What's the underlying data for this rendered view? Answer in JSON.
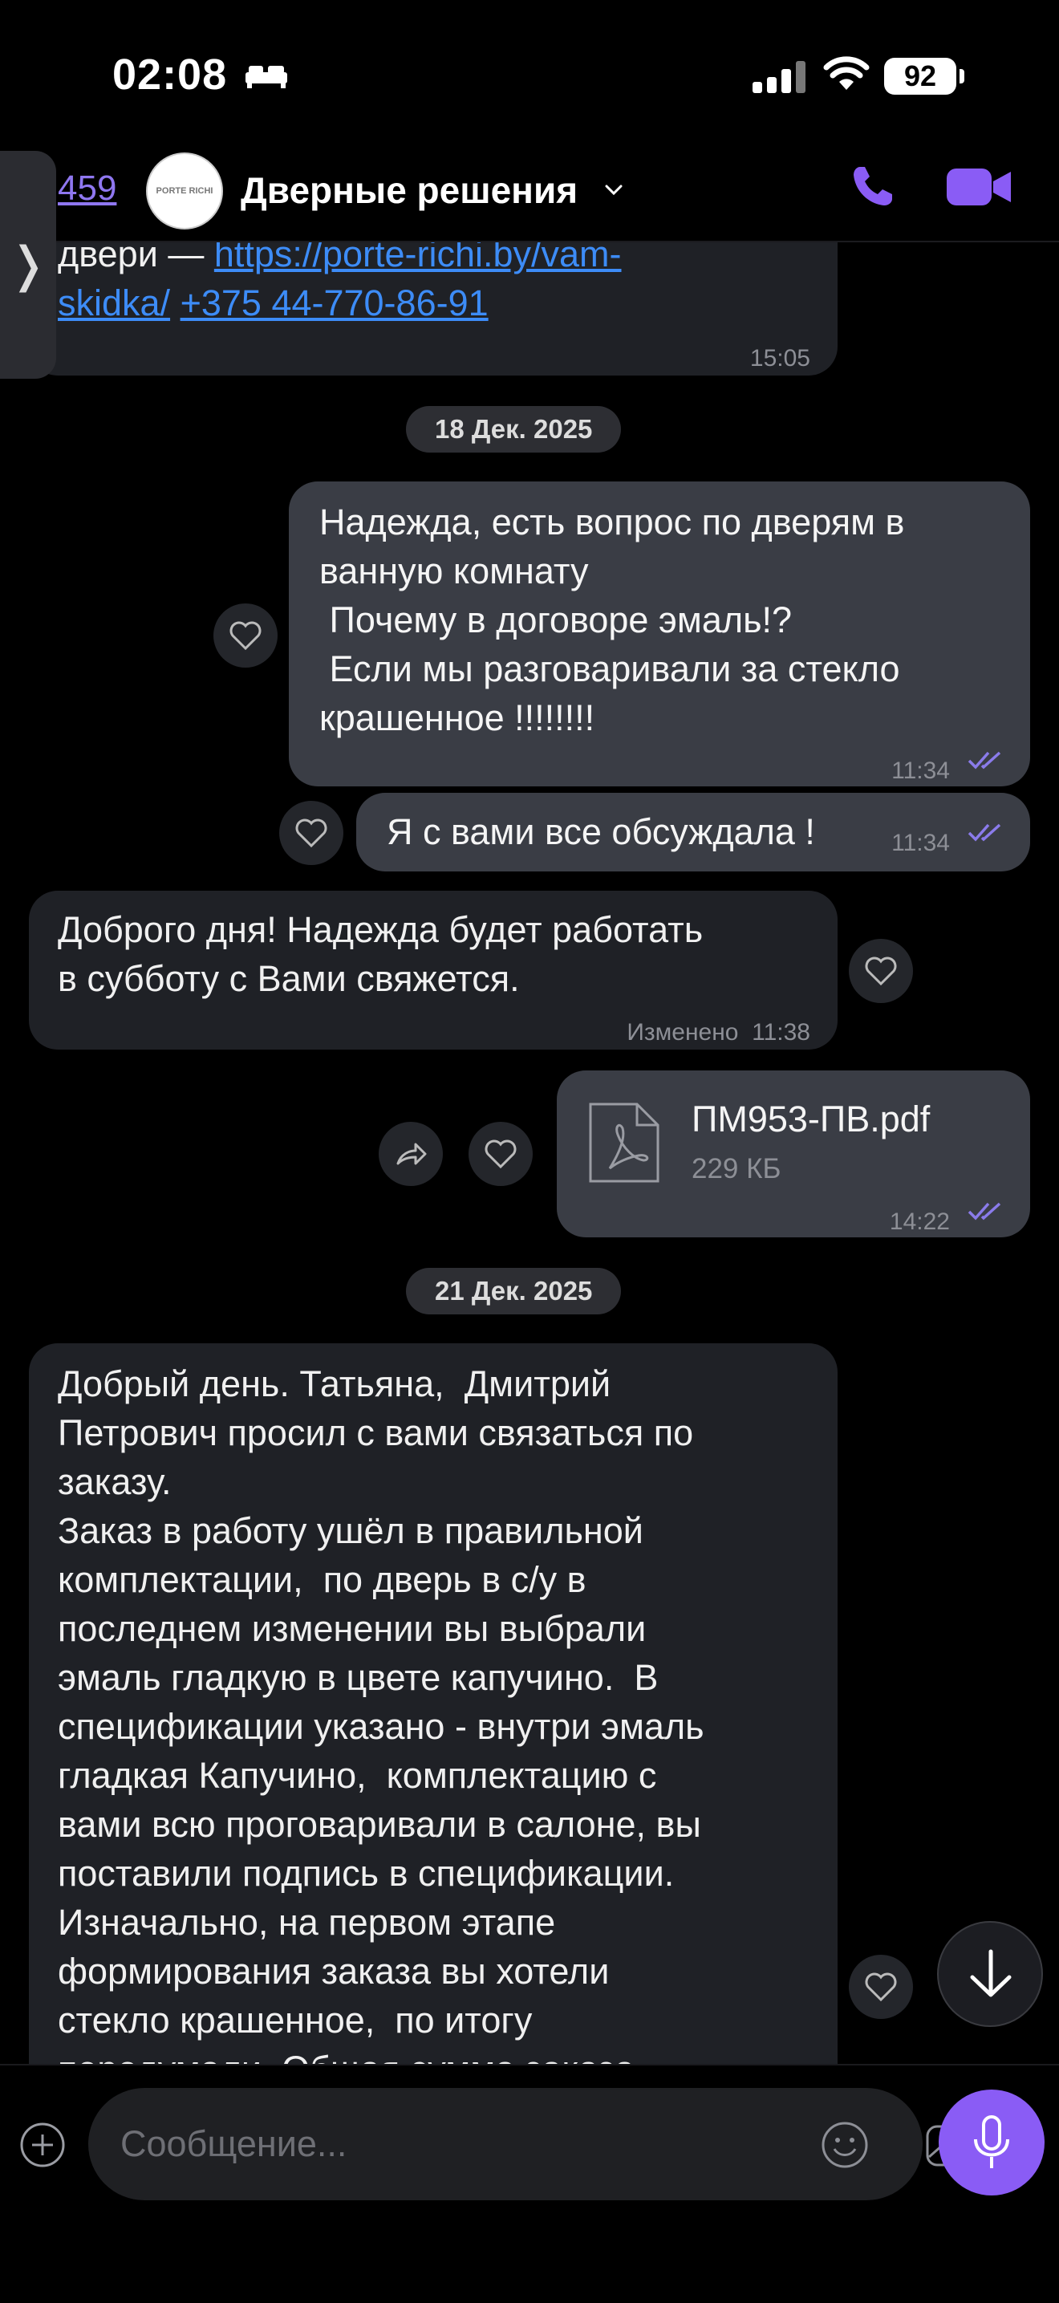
{
  "status_bar": {
    "time": "02:08",
    "battery": "92"
  },
  "header": {
    "back_count": "459",
    "avatar_text": "PORTE RICHI",
    "title": "Дверные решения"
  },
  "messages": {
    "m0": {
      "text_prefix": "двери — ",
      "link1": "https://porte-richi.by/vam-skidka/",
      "link2": "+375 44-770-86-91",
      "time": "15:05"
    },
    "date1": "18 Дек. 2025",
    "m1": {
      "line1": "Надежда, есть вопрос по дверям в",
      "line2": "ванную комнату",
      "line3": " Почему в договоре эмаль!?",
      "line4": " Если мы разговаривали за стекло",
      "line5": "крашенное !!!!!!!!",
      "time": "11:34"
    },
    "m2": {
      "text": "Я с вами все обсуждала !",
      "time": "11:34"
    },
    "m3": {
      "line1": "Доброго дня! Надежда будет работать",
      "line2": "в субботу с Вами свяжется.",
      "edited": "Изменено",
      "time": "11:38"
    },
    "m4": {
      "file_name": "ПМ953-ПВ.pdf",
      "file_size": "229 КБ",
      "time": "14:22"
    },
    "date2": "21 Дек. 2025",
    "m5": {
      "lines": [
        "Добрый день. Татьяна,  Дмитрий",
        "Петрович просил с вами связаться по",
        "заказу.",
        "Заказ в работу ушёл в правильной",
        "комплектации,  по дверь в с/у в",
        "последнем изменении вы выбрали",
        "эмаль гладкую в цвете капучино.  В",
        "спецификации указано - внутри эмаль",
        "гладкая Капучино,  комплектацию с",
        "вами всю проговаривали в салоне, вы",
        "поставили подпись в спецификации.",
        "Изначально, на первом этапе",
        "формирования заказа вы хотели",
        "стекло крашенное,  по итогу",
        "передумали. Общая сумма заказа"
      ]
    }
  },
  "composer": {
    "placeholder": "Сообщение..."
  },
  "colors": {
    "accent": "#8a5cf5",
    "link": "#3d8cf7",
    "incoming": "#1f2126",
    "outgoing": "#3a3d45"
  }
}
